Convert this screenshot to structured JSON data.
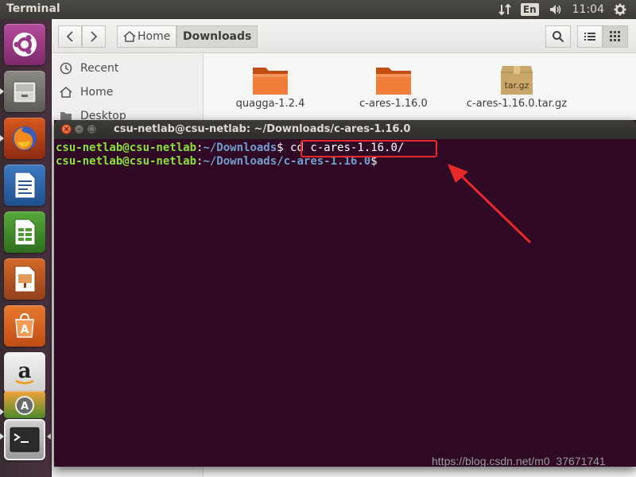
{
  "top_panel": {
    "app_title": "Terminal",
    "language": "En",
    "time": "11:04",
    "tray_icons": [
      "network-arrows-icon",
      "keyboard-lang-icon",
      "volume-icon",
      "gear-icon"
    ]
  },
  "launcher": {
    "items": [
      "ubuntu-dash",
      "files",
      "firefox",
      "libreoffice-writer",
      "libreoffice-calc",
      "libreoffice-impress",
      "ubuntu-software",
      "amazon",
      "system-updater",
      "terminal"
    ]
  },
  "files": {
    "breadcrumb": [
      {
        "label": "Home",
        "icon": "home-icon"
      },
      {
        "label": "Downloads",
        "active": true
      }
    ],
    "sidebar": [
      {
        "label": "Recent",
        "icon": "clock-icon"
      },
      {
        "label": "Home",
        "icon": "home-icon"
      },
      {
        "label": "Desktop",
        "icon": "folder-icon"
      }
    ],
    "items": [
      {
        "name": "quagga-1.2.4",
        "type": "folder"
      },
      {
        "name": "c-ares-1.16.0",
        "type": "folder"
      },
      {
        "name": "c-ares-1.16.0.tar.gz",
        "type": "archive",
        "badge": "tar.gz"
      }
    ]
  },
  "terminal": {
    "title": "csu-netlab@csu-netlab: ~/Downloads/c-ares-1.16.0",
    "lines": [
      {
        "user": "csu-netlab@csu-netlab",
        "sep": ":",
        "path": "~/Downloads",
        "prompt": "$ ",
        "command": "cd c-ares-1.16.0/"
      },
      {
        "user": "csu-netlab@csu-netlab",
        "sep": ":",
        "path": "~/Downloads/c-ares-1.16.0",
        "prompt": "$",
        "command": ""
      }
    ]
  },
  "annotation": {
    "color": "#e8292a"
  },
  "watermark": "https://blog.csdn.net/m0_37671741"
}
